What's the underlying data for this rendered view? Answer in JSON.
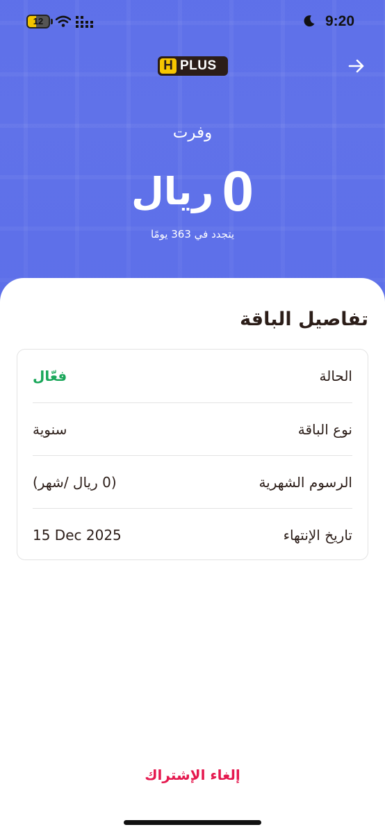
{
  "status_bar": {
    "time": "9:20",
    "battery": "12",
    "icons": [
      "moon-icon",
      "battery-icon",
      "wifi-icon",
      "signal-icon"
    ]
  },
  "header": {
    "logo_letter": "H",
    "logo_text": "PLUS",
    "back_icon": "arrow-right-icon"
  },
  "savings": {
    "label": "وفرت",
    "amount": "0",
    "unit": "ريال",
    "renewal": "يتجدد في 363 يومًا"
  },
  "details": {
    "title": "تفاصيل الباقة",
    "rows": [
      {
        "label": "الحالة",
        "value": "فعّال"
      },
      {
        "label": "نوع الباقة",
        "value": "سنوية"
      },
      {
        "label": "الرسوم الشهرية",
        "value": "(0 ريال /شهر)"
      },
      {
        "label": "تاريخ الإنتهاء",
        "value": "15 Dec 2025"
      }
    ]
  },
  "actions": {
    "cancel_label": "إلغاء الإشتراك"
  },
  "colors": {
    "hero_bg": "#5669e8",
    "active_status": "#1aa75a",
    "cancel": "#e5194f",
    "logo_yellow": "#f7c600"
  }
}
